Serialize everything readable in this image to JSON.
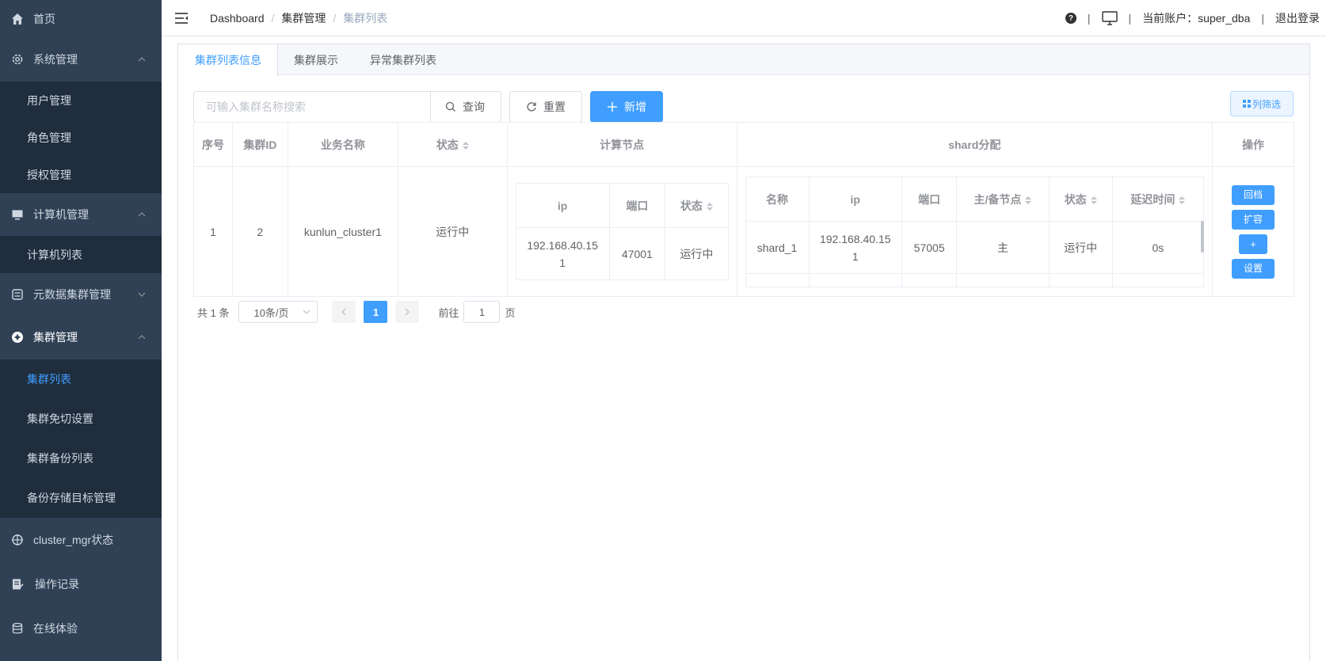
{
  "sidebar": {
    "home": "首页",
    "system": {
      "label": "系统管理",
      "items": [
        "用户管理",
        "角色管理",
        "授权管理"
      ]
    },
    "computer": {
      "label": "计算机管理",
      "items": [
        "计算机列表"
      ]
    },
    "metadata": {
      "label": "元数据集群管理"
    },
    "cluster": {
      "label": "集群管理",
      "items": [
        "集群列表",
        "集群免切设置",
        "集群备份列表",
        "备份存储目标管理"
      ]
    },
    "cluster_mgr": "cluster_mgr状态",
    "oplog": "操作记录",
    "online": "在线体验"
  },
  "navbar": {
    "breadcrumb": [
      "Dashboard",
      "集群管理",
      "集群列表"
    ],
    "account_label": "当前账户：super_dba",
    "logout": "退出登录",
    "help": "?"
  },
  "tabs": [
    "集群列表信息",
    "集群展示",
    "异常集群列表"
  ],
  "toolbar": {
    "search_placeholder": "可输入集群名称搜索",
    "query": "查询",
    "reset": "重置",
    "add": "新增",
    "column_filter": "列筛选"
  },
  "table": {
    "headers": {
      "index": "序号",
      "cluster_id": "集群ID",
      "business_name": "业务名称",
      "status": "状态",
      "compute_nodes": "计算节点",
      "shard": "shard分配",
      "actions": "操作"
    },
    "compute_headers": {
      "ip": "ip",
      "port": "端口",
      "status": "状态"
    },
    "shard_headers": {
      "name": "名称",
      "ip": "ip",
      "port": "端口",
      "role": "主/备节点",
      "status": "状态",
      "delay": "延迟时间"
    },
    "rows": [
      {
        "index": "1",
        "cluster_id": "2",
        "business_name": "kunlun_cluster1",
        "status": "运行中",
        "compute": {
          "ip": "192.168.40.151",
          "port": "47001",
          "status": "运行中"
        },
        "shard": {
          "name": "shard_1",
          "ip": "192.168.40.151",
          "port": "57005",
          "role": "主",
          "status": "运行中",
          "delay": "0s"
        }
      }
    ],
    "actions": [
      "回档",
      "扩容",
      "+",
      "设置"
    ]
  },
  "pagination": {
    "total": "共 1 条",
    "page_size": "10条/页",
    "current": "1",
    "goto": "前往",
    "goto_value": "1",
    "page_unit": "页"
  },
  "colors": {
    "primary": "#409eff",
    "success": "#13ce66",
    "sidebar": "#304156",
    "submenu": "#1f2d3d"
  }
}
